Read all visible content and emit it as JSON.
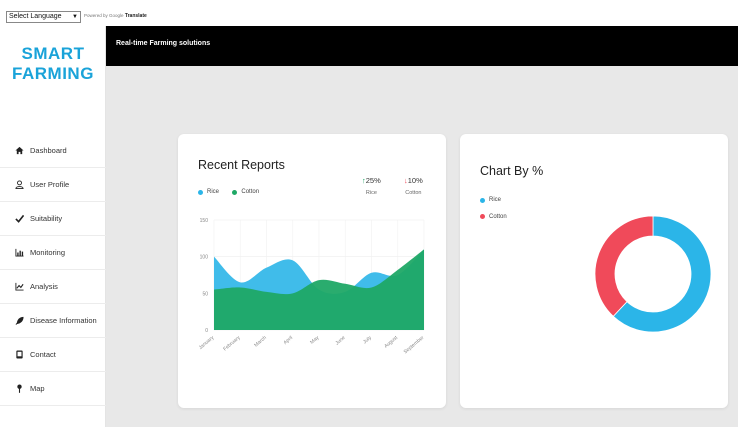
{
  "translate": {
    "select_label": "Select Language",
    "powered_by": "Powered by",
    "google": "Google",
    "translate_word": "Translate"
  },
  "brand": {
    "line1": "SMART",
    "line2": "FARMING"
  },
  "sidebar": {
    "items": [
      {
        "label": "Dashboard",
        "icon": "home-icon"
      },
      {
        "label": "User Profile",
        "icon": "user-icon"
      },
      {
        "label": "Suitability",
        "icon": "check-icon"
      },
      {
        "label": "Monitoring",
        "icon": "bar-chart-icon"
      },
      {
        "label": "Analysis",
        "icon": "line-chart-icon"
      },
      {
        "label": "Disease Information",
        "icon": "leaf-icon"
      },
      {
        "label": "Contact",
        "icon": "phone-icon"
      },
      {
        "label": "Map",
        "icon": "map-pin-icon"
      }
    ]
  },
  "topbar": {
    "title": "Real-time Farming solutions"
  },
  "colors": {
    "rice": "#2bb5e8",
    "cotton": "#1fa866",
    "cotton_pie": "#f04a5a",
    "brand": "#1aa3d9"
  },
  "reports": {
    "title": "Recent Reports",
    "legend": [
      {
        "label": "Rice"
      },
      {
        "label": "Cotton"
      }
    ],
    "stats": [
      {
        "arrow": "↑",
        "value": "25%",
        "label": "Rice",
        "color": "#1fa866"
      },
      {
        "arrow": "↓",
        "value": "10%",
        "label": "Cotton",
        "color": "#f04a5a"
      }
    ]
  },
  "pct": {
    "title": "Chart By %",
    "legend": [
      {
        "label": "Rice"
      },
      {
        "label": "Cotton"
      }
    ]
  },
  "chart_data": [
    {
      "type": "area",
      "title": "Recent Reports",
      "categories": [
        "January",
        "February",
        "March",
        "April",
        "May",
        "June",
        "July",
        "August",
        "September"
      ],
      "ylim": [
        0,
        150
      ],
      "yticks": [
        0,
        50,
        100,
        150
      ],
      "series": [
        {
          "name": "Rice",
          "values": [
            100,
            65,
            85,
            95,
            55,
            52,
            78,
            75,
            110
          ]
        },
        {
          "name": "Cotton",
          "values": [
            55,
            58,
            52,
            50,
            68,
            63,
            58,
            82,
            110
          ]
        }
      ],
      "grid": true
    },
    {
      "type": "pie",
      "title": "Chart By %",
      "donut": true,
      "series": [
        {
          "name": "Rice",
          "value": 62
        },
        {
          "name": "Cotton",
          "value": 38
        }
      ]
    }
  ]
}
